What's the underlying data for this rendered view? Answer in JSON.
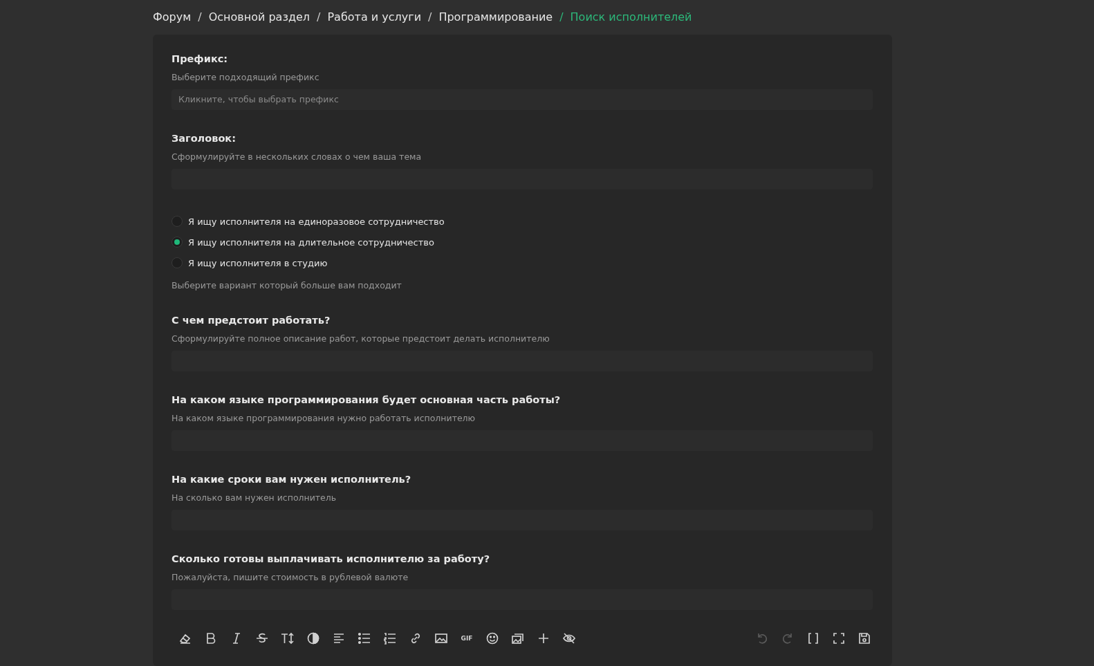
{
  "breadcrumb": [
    {
      "label": "Форум",
      "current": false
    },
    {
      "label": "Основной раздел",
      "current": false
    },
    {
      "label": "Работа и услуги",
      "current": false
    },
    {
      "label": "Программирование",
      "current": false
    },
    {
      "label": "Поиск исполнителей",
      "current": true
    }
  ],
  "breadcrumb_separator": "/",
  "fields": [
    {
      "kind": "select",
      "label": "Префикс:",
      "hint": "Выберите подходящий префикс",
      "placeholder": "Кликните, чтобы выбрать префикс"
    },
    {
      "kind": "text",
      "label": "Заголовок:",
      "hint": "Сформулируйте в нескольких словах о чем ваша тема"
    },
    {
      "kind": "radio",
      "options": [
        {
          "label": "Я ищу исполнителя на единоразовое сотрудничество",
          "selected": false
        },
        {
          "label": "Я ищу исполнителя на длительное сотрудничество",
          "selected": true
        },
        {
          "label": "Я ищу исполнителя в студию",
          "selected": false
        }
      ],
      "hint": "Выберите вариант который больше вам подходит"
    },
    {
      "kind": "text",
      "label": "С чем предстоит работать?",
      "hint": "Сформулируйте полное описание работ, которые предстоит делать исполнителю"
    },
    {
      "kind": "text",
      "label": "На каком языке программирования будет основная часть работы?",
      "hint": "На каком языке программирования нужно работать исполнителю"
    },
    {
      "kind": "text",
      "label": "На какие сроки вам нужен исполнитель?",
      "hint": "На сколько вам нужен исполнитель"
    },
    {
      "kind": "text",
      "label": "Сколько готовы выплачивать исполнителю за работу?",
      "hint": "Пожалуйста, пишите стоимость в рублевой валюте"
    }
  ],
  "toolbar": {
    "left": [
      {
        "kind": "eraser",
        "disabled": false
      },
      {
        "kind": "bold",
        "disabled": false
      },
      {
        "kind": "italic",
        "disabled": false
      },
      {
        "kind": "strike",
        "disabled": false
      },
      {
        "kind": "textsize",
        "disabled": false
      },
      {
        "kind": "contrast",
        "disabled": false
      },
      {
        "kind": "align",
        "disabled": false
      },
      {
        "kind": "bullets",
        "disabled": false
      },
      {
        "kind": "numbers",
        "disabled": false
      },
      {
        "kind": "link",
        "disabled": false
      },
      {
        "kind": "image",
        "disabled": false
      },
      {
        "kind": "gif",
        "label": "GIF",
        "disabled": false
      },
      {
        "kind": "smile",
        "disabled": false
      },
      {
        "kind": "gallery",
        "disabled": false
      },
      {
        "kind": "plus",
        "disabled": false
      },
      {
        "kind": "eye",
        "disabled": false
      }
    ],
    "right": [
      {
        "kind": "undo",
        "disabled": true
      },
      {
        "kind": "redo",
        "disabled": true
      },
      {
        "kind": "brackets",
        "disabled": false
      },
      {
        "kind": "fullscreen",
        "disabled": false
      },
      {
        "kind": "save",
        "disabled": false
      }
    ]
  }
}
